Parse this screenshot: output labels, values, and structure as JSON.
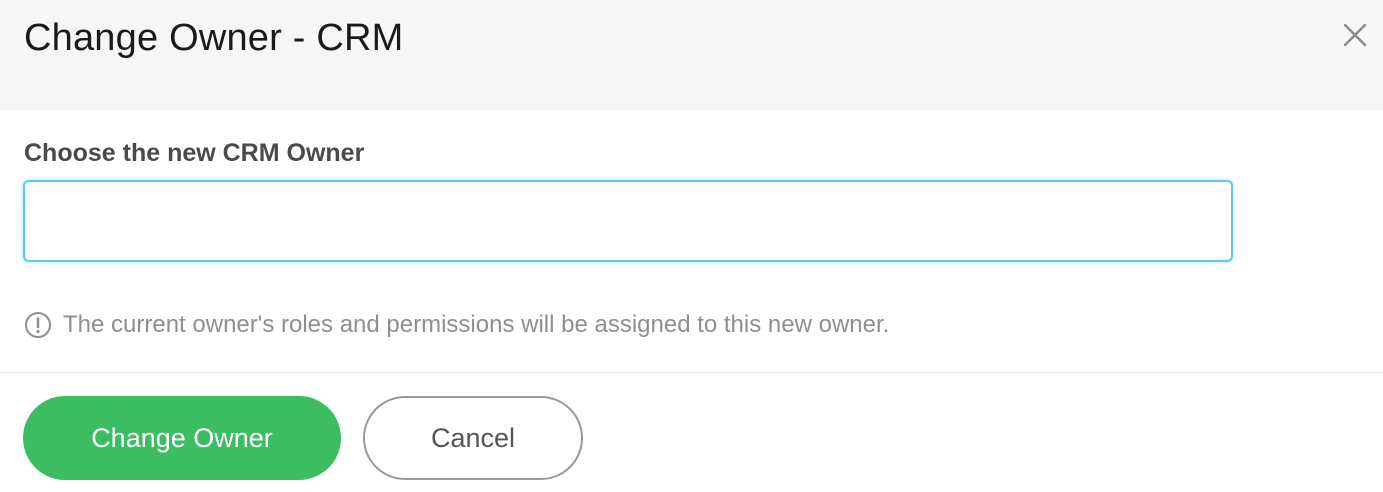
{
  "dialog": {
    "title": "Change Owner - CRM",
    "close_icon": "close-icon"
  },
  "form": {
    "owner_label": "Choose the new CRM Owner",
    "owner_value": "",
    "owner_placeholder": ""
  },
  "notice": {
    "icon": "exclamation-circle-icon",
    "text": "The current owner's roles and permissions will be assigned to this new owner."
  },
  "actions": {
    "primary_label": "Change Owner",
    "secondary_label": "Cancel"
  },
  "colors": {
    "primary": "#3dbd62",
    "input_focus_border": "#5cc8f0",
    "header_background": "#f6f6f6",
    "muted_text": "#8f8f8f"
  }
}
